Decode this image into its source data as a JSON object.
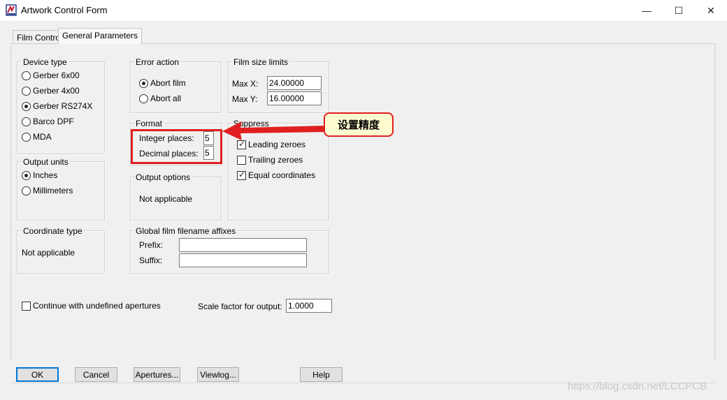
{
  "window": {
    "title": "Artwork Control Form",
    "minimize_glyph": "—",
    "maximize_glyph": "☐",
    "close_glyph": "✕"
  },
  "tabs": [
    {
      "label": "Film Control",
      "active": false
    },
    {
      "label": "General Parameters",
      "active": true
    }
  ],
  "device_type": {
    "legend": "Device type",
    "options": [
      {
        "label": "Gerber 6x00",
        "selected": false
      },
      {
        "label": "Gerber 4x00",
        "selected": false
      },
      {
        "label": "Gerber RS274X",
        "selected": true
      },
      {
        "label": "Barco DPF",
        "selected": false
      },
      {
        "label": "MDA",
        "selected": false
      }
    ]
  },
  "output_units": {
    "legend": "Output units",
    "options": [
      {
        "label": "Inches",
        "selected": true
      },
      {
        "label": "Millimeters",
        "selected": false
      }
    ]
  },
  "coordinate_type": {
    "legend": "Coordinate type",
    "text": "Not applicable"
  },
  "error_action": {
    "legend": "Error action",
    "options": [
      {
        "label": "Abort film",
        "selected": true
      },
      {
        "label": "Abort all",
        "selected": false
      }
    ]
  },
  "format": {
    "legend": "Format",
    "integer_label": "Integer places:",
    "integer_value": "5",
    "decimal_label": "Decimal places:",
    "decimal_value": "5"
  },
  "output_options": {
    "legend": "Output options",
    "text": "Not applicable"
  },
  "film_size_limits": {
    "legend": "Film size limits",
    "max_x_label": "Max X:",
    "max_x_value": "24.00000",
    "max_y_label": "Max Y:",
    "max_y_value": "16.00000"
  },
  "suppress": {
    "legend": "Suppress",
    "options": [
      {
        "label": "Leading zeroes",
        "checked": true
      },
      {
        "label": "Trailing zeroes",
        "checked": false
      },
      {
        "label": "Equal coordinates",
        "checked": true
      }
    ]
  },
  "affixes": {
    "legend": "Global film filename affixes",
    "prefix_label": "Prefix:",
    "prefix_value": "",
    "suffix_label": "Suffix:",
    "suffix_value": ""
  },
  "continue_undefined": {
    "label": "Continue with undefined apertures",
    "checked": false
  },
  "scale_factor": {
    "label": "Scale factor for output:",
    "value": "1.0000"
  },
  "buttons": {
    "ok": "OK",
    "cancel": "Cancel",
    "apertures": "Apertures...",
    "viewlog": "Viewlog...",
    "help": "Help"
  },
  "annotation": {
    "callout_text": "设置精度",
    "highlight_color": "#e02020",
    "callout_fill": "#fffbd0"
  },
  "watermark": "https://blog.csdn.net/LCCPCB"
}
